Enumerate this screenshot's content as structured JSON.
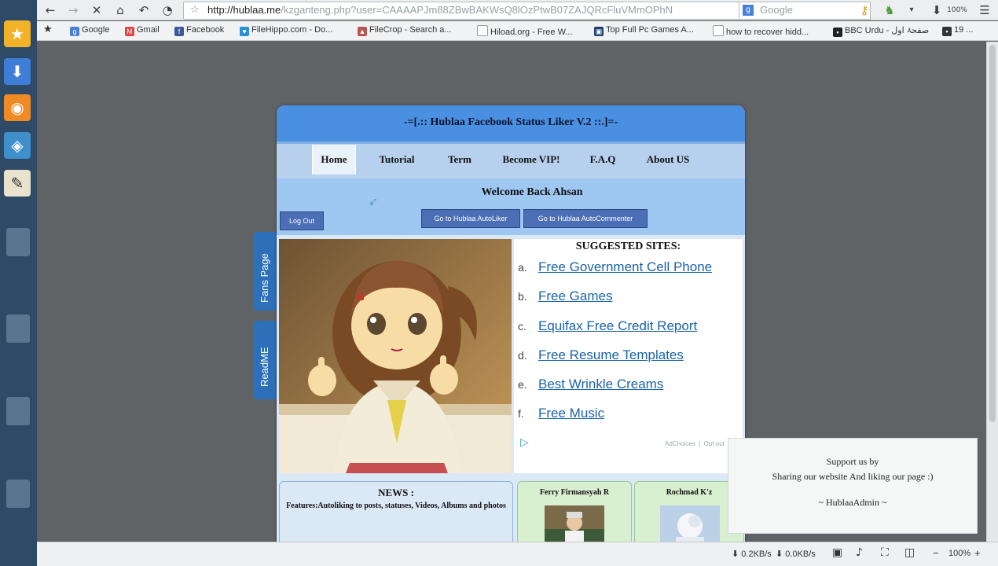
{
  "browser": {
    "url_host": "http://hublaa.me",
    "url_path": "/kzganteng.php?user=CAAAAPJm88ZBwBAKWsQ8lOzPtwB07ZAJQRcFluVMmOPhN",
    "search_placeholder": "Google",
    "zoom": "100%",
    "bookmarks": [
      {
        "label": "Google"
      },
      {
        "label": "Gmail"
      },
      {
        "label": "Facebook"
      },
      {
        "label": "FileHippo.com - Do..."
      },
      {
        "label": "FileCrop - Search a..."
      },
      {
        "label": "Hiload.org - Free W..."
      },
      {
        "label": "Top Full Pc Games A..."
      },
      {
        "label": "how to recover hidd..."
      },
      {
        "label": "BBC Urdu - صفحۂ اول"
      },
      {
        "label": "19 ..."
      }
    ],
    "status": {
      "down": "0.2KB/s",
      "up": "0.0KB/s",
      "zoom": "100%"
    }
  },
  "page": {
    "title": "-=[.:: Hublaa Facebook Status Liker V.2 ::.]=-",
    "nav": [
      "Home",
      "Tutorial",
      "Term",
      "Become VIP!",
      "F.A.Q",
      "About US"
    ],
    "welcome": "Welcome Back Ahsan",
    "logout": "Log Out",
    "btn_autoliker": "Go to Hublaa AutoLiker",
    "btn_autocommenter": "Go to Hublaa AutoCommenter",
    "side_tabs": [
      "Fans Page",
      "ReadME"
    ],
    "suggested_title": "SUGGESTED SITES:",
    "suggested": [
      {
        "letter": "a.",
        "label": "Free Government Cell Phone"
      },
      {
        "letter": "b.",
        "label": "Free Games"
      },
      {
        "letter": "c.",
        "label": "Equifax Free Credit Report"
      },
      {
        "letter": "d.",
        "label": "Free Resume Templates"
      },
      {
        "letter": "e.",
        "label": "Best Wrinkle Creams"
      },
      {
        "letter": "f.",
        "label": "Free Music"
      }
    ],
    "ad_note": "AdChoices",
    "ad_optout": "Opt out",
    "news_title": "NEWS :",
    "news_text": "Features:Autoliking to posts, statuses, Videos, Albums and photos",
    "person1": "Ferry Firmansyah R",
    "person2": "Rochmad K'z",
    "support_line1": "Support us by",
    "support_line2": "Sharing our website And liking our page :)",
    "support_sign": "~ HublaaAdmin ~"
  }
}
